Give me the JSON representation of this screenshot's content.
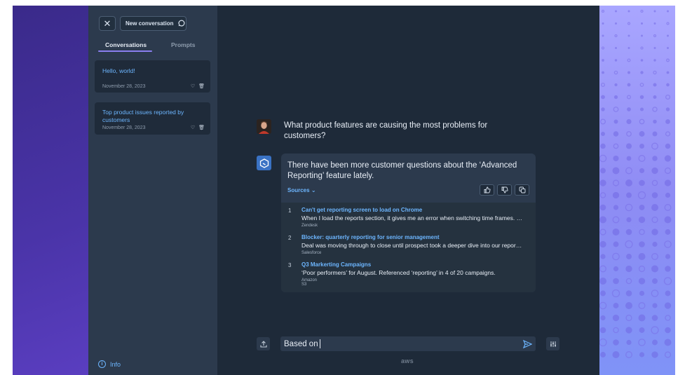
{
  "sidebar": {
    "close_icon": "close-icon",
    "new_conversation_label": "New conversation",
    "new_conversation_icon": "chat-bubble-icon",
    "tabs": [
      {
        "label": "Conversations",
        "active": true
      },
      {
        "label": "Prompts",
        "active": false
      }
    ],
    "conversations": [
      {
        "title": "Hello, world!",
        "date": "November 28, 2023"
      },
      {
        "title": "Top product issues reported by customers",
        "date": "November 28, 2023"
      }
    ],
    "info_label": "Info"
  },
  "chat": {
    "user_question": "What product features are causing the most problems for customers?",
    "answer": "There have been more customer questions about the ‘Advanced Reporting’ feature lately.",
    "sources_label": "Sources",
    "sources": [
      {
        "num": "1",
        "title": "Can't get reporting screen to load on Chrome",
        "desc": "When I load the reports section, it gives me an error when switching time frames. …",
        "origin": "Zendesk"
      },
      {
        "num": "2",
        "title": "Blocker: quarterly reporting for senior management",
        "desc": "Deal was moving through to close until prospect took a deeper dive into our repor…",
        "origin": "Salesforce"
      },
      {
        "num": "3",
        "title": "Q3 Markerting Campaigns",
        "desc": "‘Poor performers’ for August. Referenced ‘reporting’ in 4 of 20 campaigns.",
        "origin": "Amazon S3"
      }
    ]
  },
  "composer": {
    "input_value": "Based on"
  },
  "footer": {
    "logo_text": "aws"
  },
  "colors": {
    "accent": "#8a7ff0",
    "link": "#6db6ff"
  }
}
